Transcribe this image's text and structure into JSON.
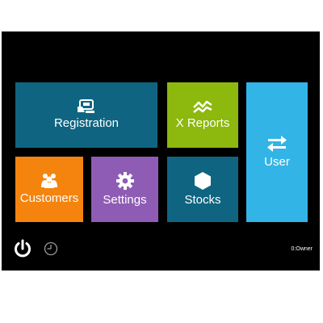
{
  "tiles": {
    "registration": {
      "label": "Registration",
      "color": "#0f6581",
      "icon": "cash-register-icon"
    },
    "x_reports": {
      "label": "X Reports",
      "color": "#8db80e",
      "icon": "trend-chart-icon"
    },
    "user": {
      "label": "User",
      "color": "#33b4e7",
      "icon": "swap-arrows-icon"
    },
    "customers": {
      "label": "Customers",
      "color": "#f4840e",
      "icon": "customers-group-icon"
    },
    "settings": {
      "label": "Settings",
      "color": "#8e5cb4",
      "icon": "gear-icon"
    },
    "stocks": {
      "label": "Stocks",
      "color": "#0f6581",
      "icon": "box-hexagon-icon"
    }
  },
  "footer": {
    "power_icon": "power-icon",
    "clock_icon": "clock-icon",
    "user_status": "0:Owner"
  },
  "colors": {
    "background": "#000000"
  }
}
